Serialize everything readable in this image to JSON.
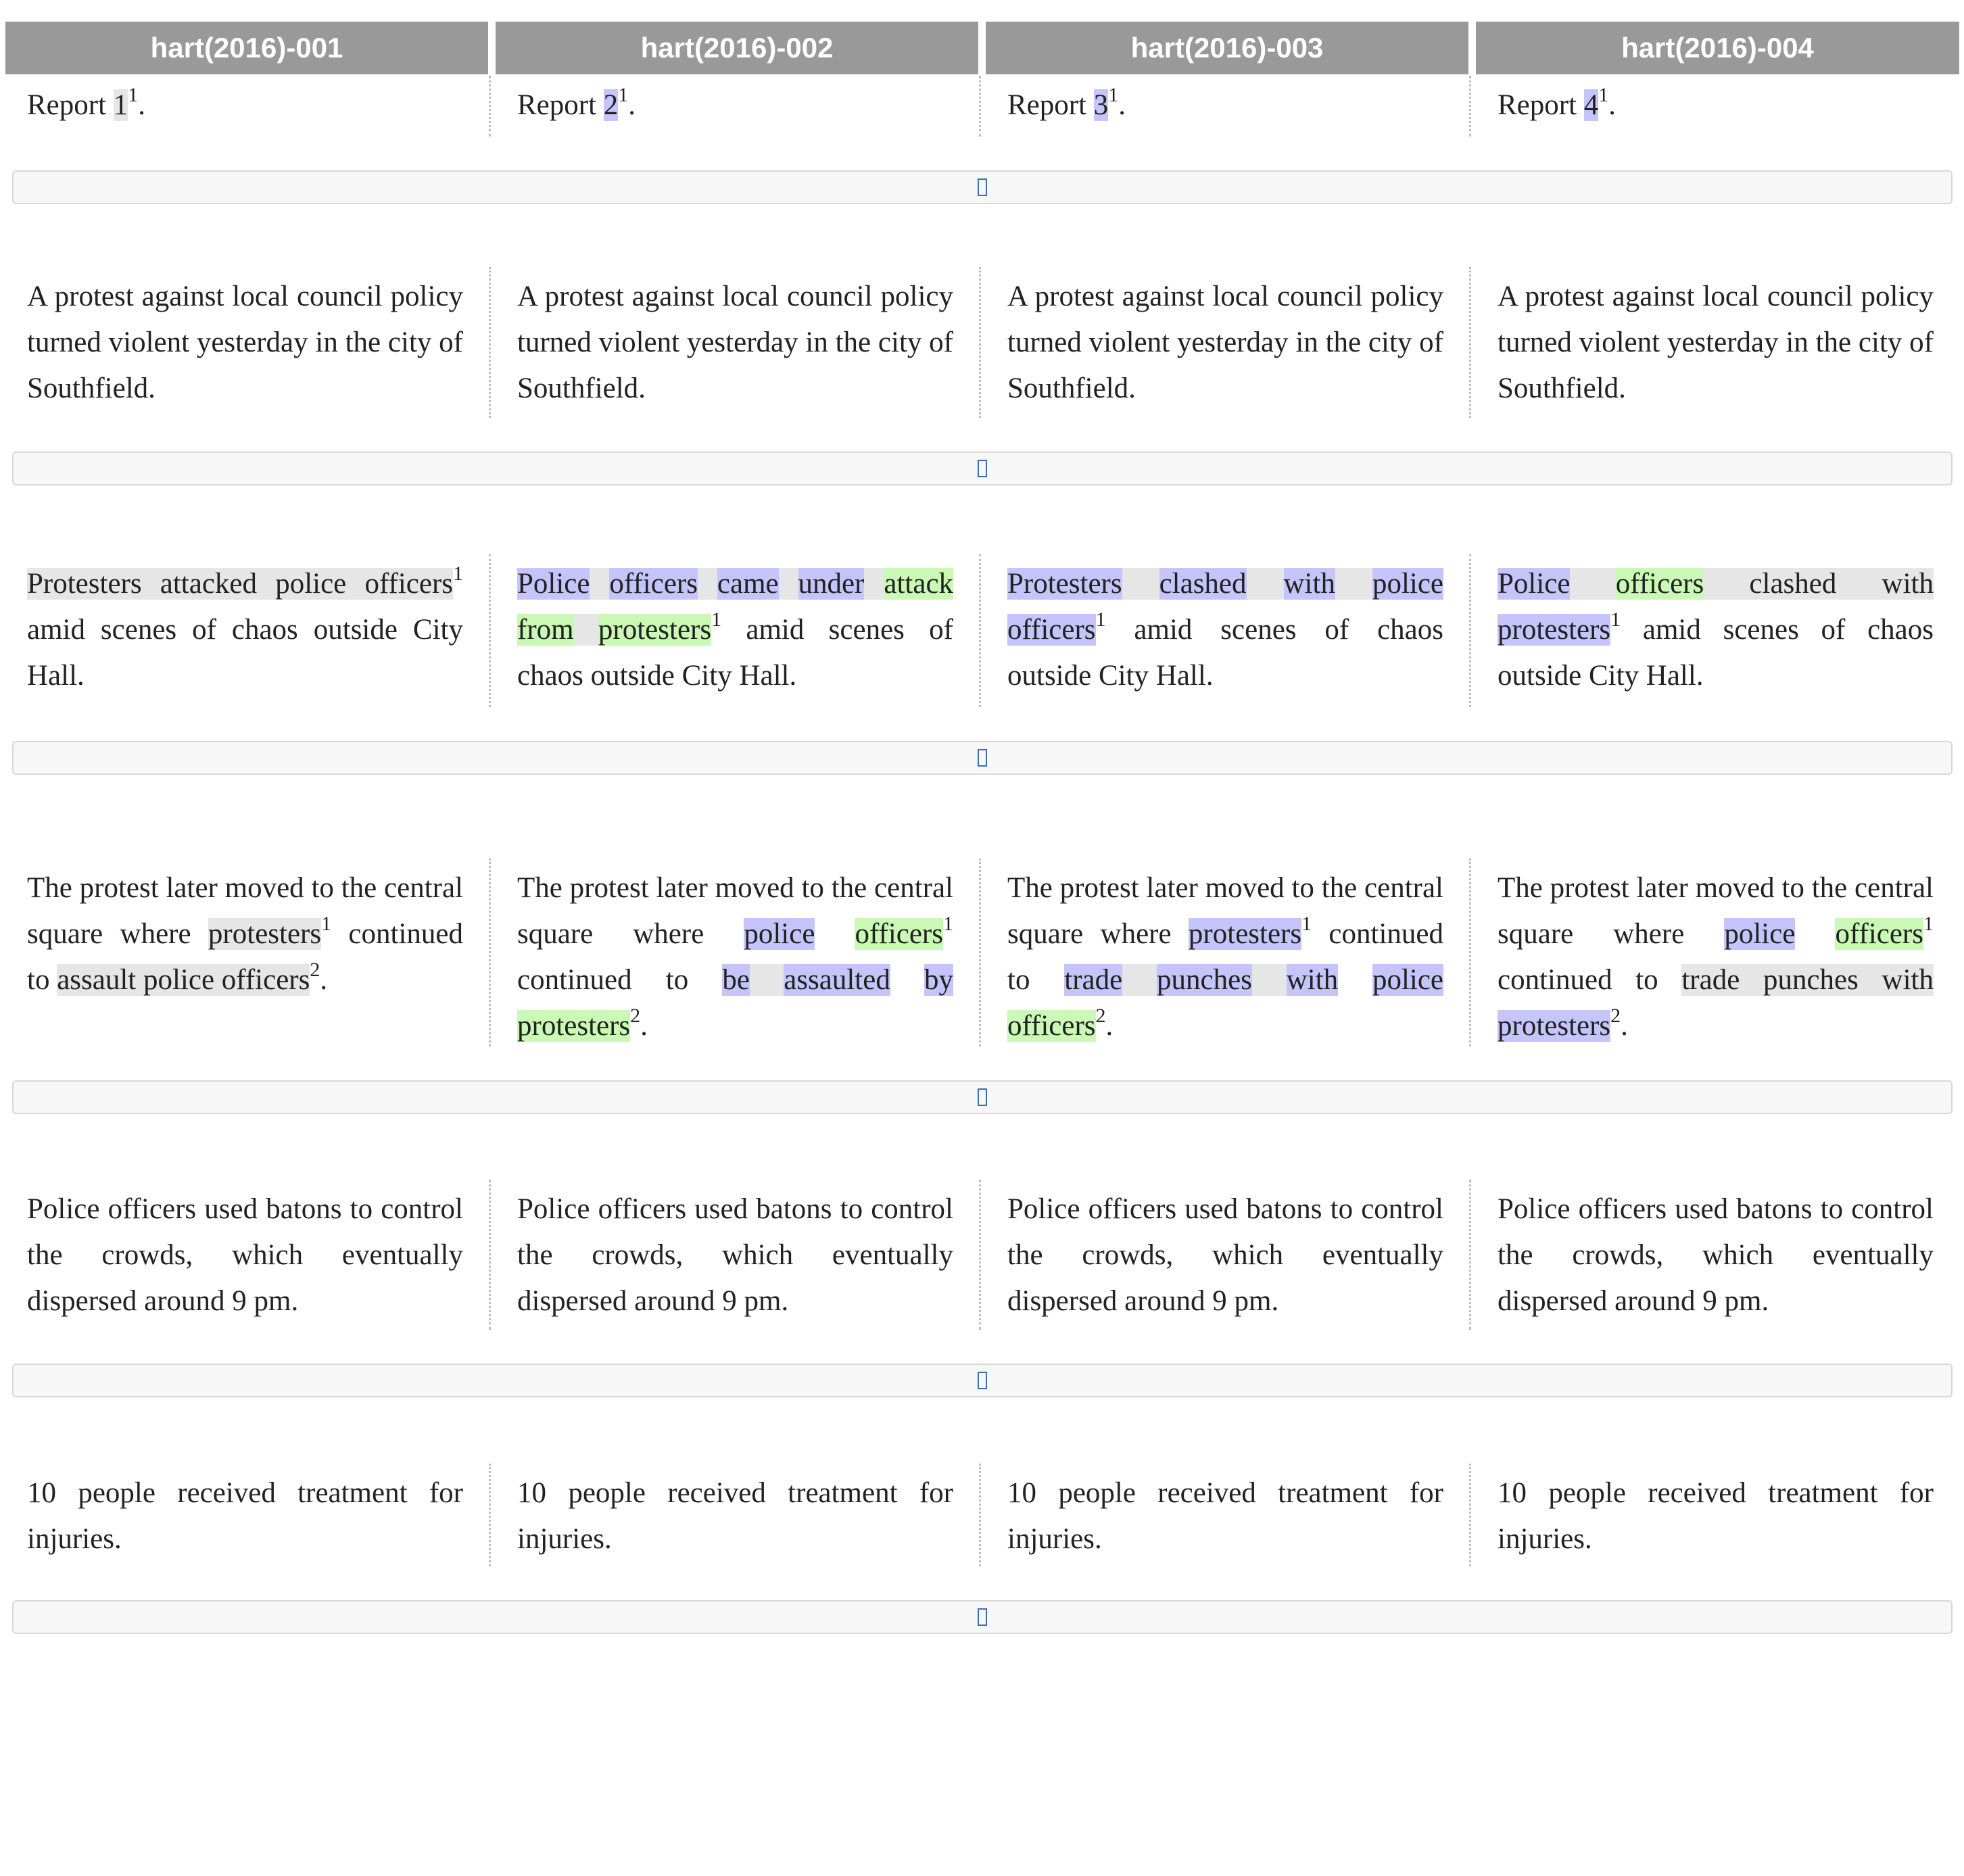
{
  "columns": [
    {
      "header": "hart(2016)-001"
    },
    {
      "header": "hart(2016)-002"
    },
    {
      "header": "hart(2016)-003"
    },
    {
      "header": "hart(2016)-004"
    }
  ],
  "highlight_colors": {
    "grey": "#e6e6e6",
    "blue": "#c5c5fb",
    "green": "#c9f9b5"
  },
  "separator_icon": "expand-icon",
  "rows": [
    {
      "cells": [
        [
          {
            "t": "Report "
          },
          {
            "t": "1",
            "h": "g"
          },
          {
            "t": "1",
            "sup": true
          },
          {
            "t": "."
          }
        ],
        [
          {
            "t": "Report "
          },
          {
            "t": "2",
            "h": "b"
          },
          {
            "t": "1",
            "sup": true
          },
          {
            "t": "."
          }
        ],
        [
          {
            "t": "Report "
          },
          {
            "t": "3",
            "h": "b"
          },
          {
            "t": "1",
            "sup": true
          },
          {
            "t": "."
          }
        ],
        [
          {
            "t": "Report "
          },
          {
            "t": "4",
            "h": "b"
          },
          {
            "t": "1",
            "sup": true
          },
          {
            "t": "."
          }
        ]
      ]
    },
    {
      "cells": [
        [
          {
            "t": "A protest against local council policy turned violent yesterday in the city of Southfield."
          }
        ],
        [
          {
            "t": "A protest against local council policy turned violent yesterday in the city of Southfield."
          }
        ],
        [
          {
            "t": "A protest against local council policy turned violent yesterday in the city of Southfield."
          }
        ],
        [
          {
            "t": "A protest against local council policy turned violent yesterday in the city of Southfield."
          }
        ]
      ]
    },
    {
      "cells": [
        [
          {
            "t": "Protesters attacked police officers",
            "h": "g"
          },
          {
            "t": "1",
            "sup": true
          },
          {
            "t": " amid scenes of chaos outside City Hall."
          }
        ],
        [
          {
            "t": "Police",
            "h": "b"
          },
          {
            "t": " ",
            "h": "g"
          },
          {
            "t": "officers",
            "h": "b"
          },
          {
            "t": " ",
            "h": "g"
          },
          {
            "t": "came",
            "h": "b"
          },
          {
            "t": " ",
            "h": "g"
          },
          {
            "t": "under",
            "h": "b"
          },
          {
            "t": " ",
            "h": "g"
          },
          {
            "t": "attack",
            "h": "l"
          },
          {
            "t": " "
          },
          {
            "t": "from",
            "h": "l"
          },
          {
            "t": " ",
            "h": "g"
          },
          {
            "t": "protesters",
            "h": "l"
          },
          {
            "t": "1",
            "sup": true
          },
          {
            "t": " amid scenes of chaos outside City Hall."
          }
        ],
        [
          {
            "t": "Protesters",
            "h": "b"
          },
          {
            "t": " ",
            "h": "g"
          },
          {
            "t": "clashed",
            "h": "b"
          },
          {
            "t": " ",
            "h": "g"
          },
          {
            "t": "with",
            "h": "b"
          },
          {
            "t": " ",
            "h": "g"
          },
          {
            "t": "police",
            "h": "b"
          },
          {
            "t": " "
          },
          {
            "t": "officers",
            "h": "b"
          },
          {
            "t": "1",
            "sup": true
          },
          {
            "t": " amid scenes of chaos outside City Hall."
          }
        ],
        [
          {
            "t": "Police",
            "h": "b"
          },
          {
            "t": " ",
            "h": "g"
          },
          {
            "t": "officers",
            "h": "l"
          },
          {
            "t": " clashed with ",
            "h": "g"
          },
          {
            "t": "protesters",
            "h": "b"
          },
          {
            "t": "1",
            "sup": true
          },
          {
            "t": " amid scenes of chaos outside City Hall."
          }
        ]
      ]
    },
    {
      "cells": [
        [
          {
            "t": "The protest later moved to the central square where "
          },
          {
            "t": "protesters",
            "h": "g"
          },
          {
            "t": "1",
            "sup": true
          },
          {
            "t": " continued to "
          },
          {
            "t": "assault police officers",
            "h": "g"
          },
          {
            "t": "2",
            "sup": true
          },
          {
            "t": "."
          }
        ],
        [
          {
            "t": "The protest later moved to the central square where "
          },
          {
            "t": "police",
            "h": "b"
          },
          {
            "t": " "
          },
          {
            "t": "officers",
            "h": "l"
          },
          {
            "t": "1",
            "sup": true
          },
          {
            "t": " continued to "
          },
          {
            "t": "be",
            "h": "b"
          },
          {
            "t": " ",
            "h": "g"
          },
          {
            "t": "assaulted",
            "h": "b"
          },
          {
            "t": " "
          },
          {
            "t": "by",
            "h": "b"
          },
          {
            "t": " ",
            "h": "g"
          },
          {
            "t": "protesters",
            "h": "l"
          },
          {
            "t": "2",
            "sup": true
          },
          {
            "t": "."
          }
        ],
        [
          {
            "t": "The protest later moved to the central square where "
          },
          {
            "t": "protesters",
            "h": "b"
          },
          {
            "t": "1",
            "sup": true
          },
          {
            "t": " continued to "
          },
          {
            "t": "trade",
            "h": "b"
          },
          {
            "t": " ",
            "h": "g"
          },
          {
            "t": "punches",
            "h": "b"
          },
          {
            "t": " ",
            "h": "g"
          },
          {
            "t": "with",
            "h": "b"
          },
          {
            "t": " "
          },
          {
            "t": "police",
            "h": "b"
          },
          {
            "t": " ",
            "h": "g"
          },
          {
            "t": "officers",
            "h": "l"
          },
          {
            "t": "2",
            "sup": true
          },
          {
            "t": "."
          }
        ],
        [
          {
            "t": "The protest later moved to the central square where "
          },
          {
            "t": "police",
            "h": "b"
          },
          {
            "t": " "
          },
          {
            "t": "officers",
            "h": "l"
          },
          {
            "t": "1",
            "sup": true
          },
          {
            "t": " continued to "
          },
          {
            "t": "trade punches with ",
            "h": "g"
          },
          {
            "t": "protesters",
            "h": "b"
          },
          {
            "t": "2",
            "sup": true
          },
          {
            "t": "."
          }
        ]
      ]
    },
    {
      "cells": [
        [
          {
            "t": "Police officers used batons to control the crowds, which eventually dispersed around 9 pm."
          }
        ],
        [
          {
            "t": "Police officers used batons to control the crowds, which eventually dispersed around 9 pm."
          }
        ],
        [
          {
            "t": "Police officers used batons to control the crowds, which eventually dispersed around 9 pm."
          }
        ],
        [
          {
            "t": "Police officers used batons to control the crowds, which eventually dispersed around 9 pm."
          }
        ]
      ]
    },
    {
      "cells": [
        [
          {
            "t": "10 people received treatment for injuries."
          }
        ],
        [
          {
            "t": "10 people received treatment for injuries."
          }
        ],
        [
          {
            "t": "10 people received treatment for injuries."
          }
        ],
        [
          {
            "t": "10 people received treatment for injuries."
          }
        ]
      ]
    }
  ]
}
